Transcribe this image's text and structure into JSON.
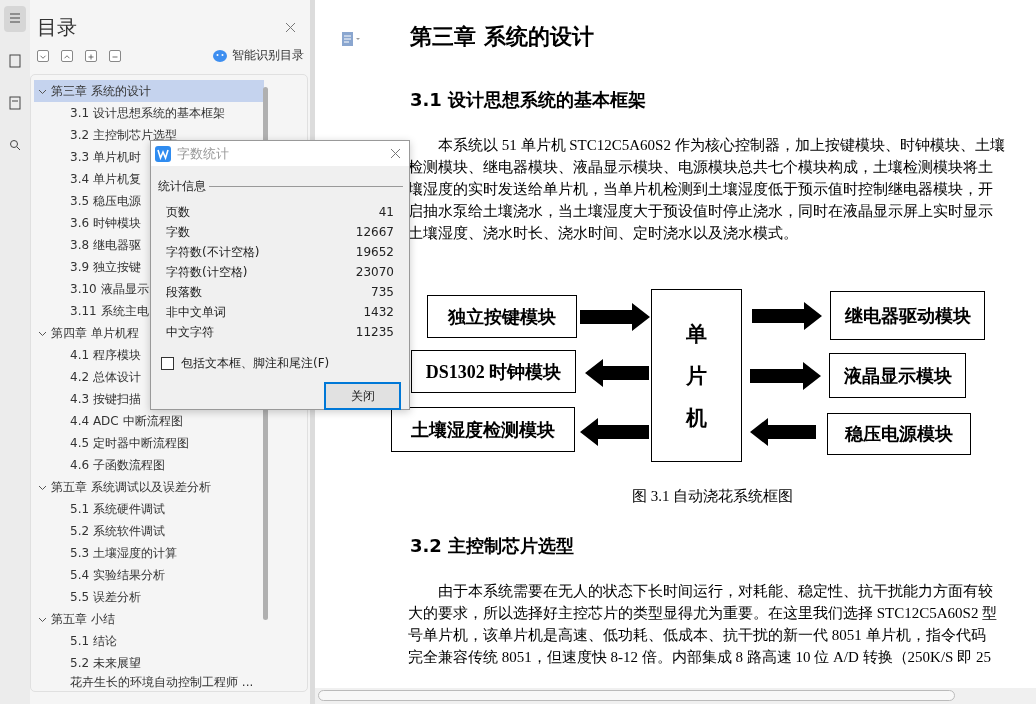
{
  "sidebar": {
    "title": "目录",
    "smart_toc": "智能识别目录",
    "items": [
      {
        "label": "第三章  系统的设计",
        "selected": true,
        "expanded": true,
        "children": [
          {
            "label": "3.1 设计思想系统的基本框架"
          },
          {
            "label": "3.2 主控制芯片选型"
          },
          {
            "label": "3.3 单片机时"
          },
          {
            "label": "3.4 单片机复"
          },
          {
            "label": "3.5 稳压电源"
          },
          {
            "label": "3.6 时钟模块"
          },
          {
            "label": "3.8 继电器驱"
          },
          {
            "label": "3.9 独立按键"
          },
          {
            "label": "3.10 液晶显示"
          },
          {
            "label": "3.11 系统主电"
          }
        ]
      },
      {
        "label": "第四章  单片机程",
        "selected": false,
        "expanded": true,
        "children": [
          {
            "label": "4.1 程序模块"
          },
          {
            "label": "4.2 总体设计"
          },
          {
            "label": "4.3 按键扫描"
          },
          {
            "label": "4.4 ADC 中断流程图"
          },
          {
            "label": "4.5  定时器中断流程图"
          },
          {
            "label": "4.6 子函数流程图"
          }
        ]
      },
      {
        "label": "第五章  系统调试以及误差分析",
        "selected": false,
        "expanded": true,
        "children": [
          {
            "label": "5.1  系统硬件调试"
          },
          {
            "label": "5.2  系统软件调试"
          },
          {
            "label": "5.3 土壤湿度的计算"
          },
          {
            "label": "5.4 实验结果分析"
          },
          {
            "label": "5.5 误差分析"
          }
        ]
      },
      {
        "label": "第五章  小结",
        "selected": false,
        "expanded": true,
        "children": [
          {
            "label": "5.1 结论"
          },
          {
            "label": "5.2  未来展望"
          }
        ]
      },
      {
        "label": "花卉生长的环境自动控制工程师 ...",
        "selected": false,
        "kind": "entry"
      }
    ]
  },
  "dialog": {
    "title": "字数统计",
    "group": "统计信息",
    "stats": [
      {
        "label": "页数",
        "value": "41"
      },
      {
        "label": "字数",
        "value": "12667"
      },
      {
        "label": "字符数(不计空格)",
        "value": "19652"
      },
      {
        "label": "字符数(计空格)",
        "value": "23070"
      },
      {
        "label": "段落数",
        "value": "735"
      },
      {
        "label": "非中文单词",
        "value": "1432"
      },
      {
        "label": "中文字符",
        "value": "11235"
      }
    ],
    "checkbox": {
      "label": "包括文本框、脚注和尾注(F)",
      "checked": false
    },
    "button": "关闭"
  },
  "document": {
    "chapter": "第三章  系统的设计",
    "section_1": "3.1 设计思想系统的基本框架",
    "paragraph_1": [
      "本系统以 51 单片机 STC12C5A60S2 作为核心控制器，加上按键模块、时钟模块、土壤",
      "检测模块、继电器模块、液晶显示模块、电源模块总共七个模块构成，土壤检测模块将土",
      "壤湿度的实时发送给单片机，当单片机检测到土壤湿度低于预示值时控制继电器模块，开",
      "启抽水泵给土壤浇水，当土壤湿度大于预设值时停止浇水，同时在液晶显示屏上实时显示",
      "土壤湿度、浇水时长、浇水时间、定时浇水以及浇水模式。"
    ],
    "diagram": {
      "nodes": [
        {
          "label": "独立按键模块",
          "kind": "module"
        },
        {
          "label": "DS1302 时钟模块",
          "kind": "module"
        },
        {
          "label": "土壤湿度检测模块",
          "kind": "module"
        },
        {
          "label": "单片机",
          "kind": "core"
        },
        {
          "label": "继电器驱动模块",
          "kind": "module"
        },
        {
          "label": "液晶显示模块",
          "kind": "module"
        },
        {
          "label": "稳压电源模块",
          "kind": "module"
        }
      ]
    },
    "caption": "图 3.1 自动浇花系统框图",
    "section_2": "3.2 主控制芯片选型",
    "paragraph_2": [
      "由于本系统需要在无人的状态下长时间运行，对耗能、稳定性、抗干扰能力方面有较",
      "大的要求，所以选择好主控芯片的类型显得尤为重要。在这里我们选择 STC12C5A60S2 型",
      "号单片机，该单片机是高速、低功耗、低成本、抗干扰的新一代 8051 单片机，指令代码",
      "完全兼容传统 8051，但速度快 8-12 倍。内部集成 8 路高速 10 位 A/D 转换（250K/S 即 25"
    ]
  }
}
